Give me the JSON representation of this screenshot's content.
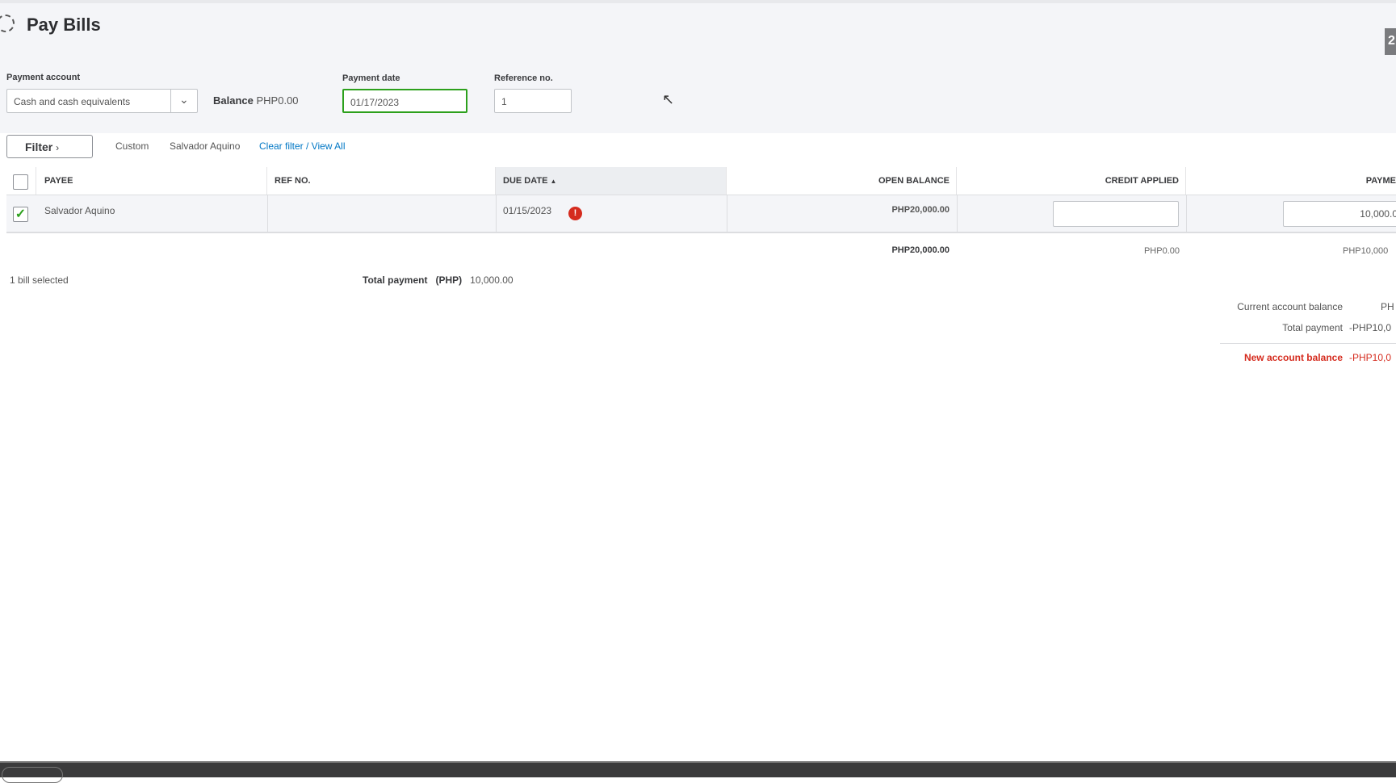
{
  "header": {
    "title": "Pay Bills",
    "badge": "2"
  },
  "form": {
    "payment_account_label": "Payment account",
    "payment_account_value": "Cash and cash equivalents",
    "balance_label": "Balance",
    "balance_value": "PHP0.00",
    "payment_date_label": "Payment date",
    "payment_date_value": "01/17/2023",
    "reference_label": "Reference no.",
    "reference_value": "1"
  },
  "filter": {
    "button_label": "Filter",
    "chips": [
      "Custom",
      "Salvador Aquino"
    ],
    "clear_link": "Clear filter / View All"
  },
  "table": {
    "columns": [
      "PAYEE",
      "REF NO.",
      "DUE DATE",
      "OPEN BALANCE",
      "CREDIT APPLIED",
      "PAYME"
    ],
    "rows": [
      {
        "checked": true,
        "payee": "Salvador Aquino",
        "ref_no": "",
        "due_date": "01/15/2023",
        "open_balance": "PHP20,000.00",
        "credit_applied": "",
        "payment": "10,000.0"
      }
    ],
    "totals": {
      "open_balance": "PHP20,000.00",
      "credit_applied": "PHP0.00",
      "payment": "PHP10,000"
    }
  },
  "footer": {
    "selected": "1 bill selected",
    "total_label": "Total payment",
    "currency": "(PHP)",
    "total_value": "10,000.00"
  },
  "summary": {
    "current_label": "Current account balance",
    "current_value": "PH",
    "total_label": "Total payment",
    "total_value": "-PHP10,0",
    "new_label": "New account balance",
    "new_value": "-PHP10,0"
  },
  "colors": {
    "accent_green": "#2ca01c",
    "link": "#0077c5",
    "error": "#d52b1e"
  }
}
